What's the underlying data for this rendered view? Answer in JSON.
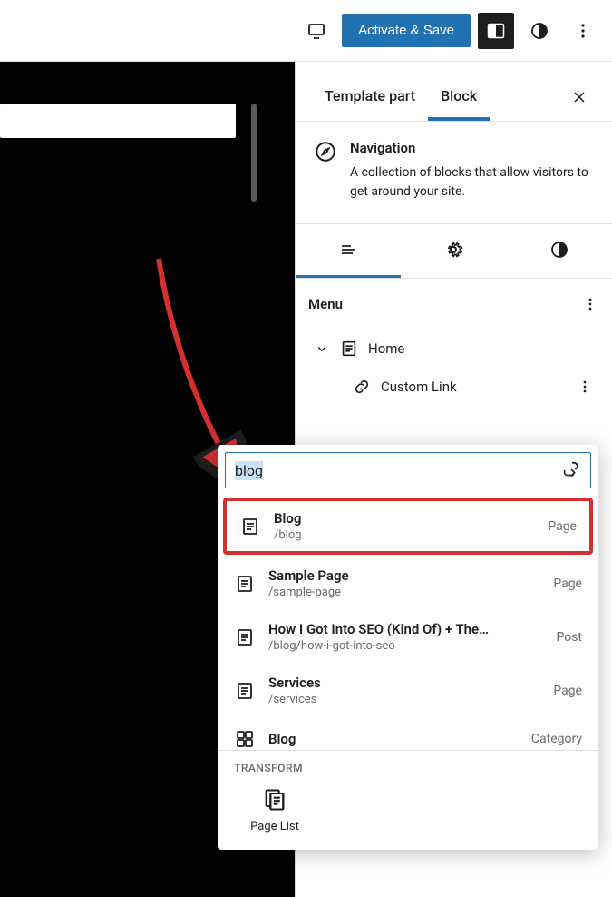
{
  "topbar": {
    "activate_label": "Activate & Save"
  },
  "sidebar": {
    "tabs": [
      {
        "label": "Template part"
      },
      {
        "label": "Block"
      }
    ],
    "block": {
      "title": "Navigation",
      "desc": "A collection of blocks that allow visitors to get around your site."
    },
    "menu": {
      "heading": "Menu",
      "items": [
        {
          "label": "Home"
        },
        {
          "label": "Custom Link"
        }
      ]
    }
  },
  "search": {
    "value": "blog",
    "results": [
      {
        "title": "Blog",
        "sub": "/blog",
        "type": "Page",
        "highlight": true
      },
      {
        "title": "Sample Page",
        "sub": "/sample-page",
        "type": "Page"
      },
      {
        "title": "How I Got Into SEO (Kind Of) + The…",
        "sub": "/blog/how-i-got-into-seo",
        "type": "Post"
      },
      {
        "title": "Services",
        "sub": "/services",
        "type": "Page"
      },
      {
        "title": "Blog",
        "sub": "",
        "type": "Category"
      }
    ],
    "transform": {
      "label": "TRANSFORM",
      "item": "Page List"
    }
  }
}
